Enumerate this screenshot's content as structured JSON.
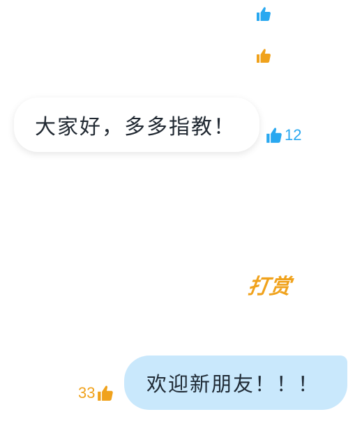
{
  "colors": {
    "like_blue": "#29a8f0",
    "like_orange": "#f0a21c",
    "bubble_out": "#c9e8fc",
    "bubble_in": "#ffffff",
    "text": "#222a33"
  },
  "reactions_top": [
    {
      "icon": "thumbs-up-icon",
      "color": "#29a8f0"
    },
    {
      "icon": "thumbs-up-icon",
      "color": "#f0a21c"
    }
  ],
  "messages": [
    {
      "direction": "incoming",
      "text": "大家好，多多指教！",
      "likes": "12",
      "like_icon": "thumbs-up-icon",
      "like_color": "#29a8f0"
    },
    {
      "direction": "outgoing",
      "text": "欢迎新朋友！！！",
      "likes": "33",
      "like_icon": "thumbs-up-icon",
      "like_color": "#f0a21c"
    }
  ],
  "reward": {
    "label": "打赏",
    "color": "#f0a21c"
  }
}
